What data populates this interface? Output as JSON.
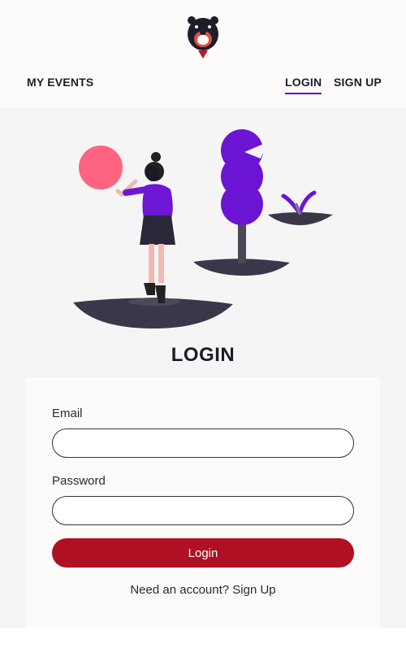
{
  "header": {
    "logo_icon": "bear-mascot-icon",
    "nav_left": "MY EVENTS",
    "nav_login": "LOGIN",
    "nav_signup": "SIGN UP",
    "accent": "#5a0fc8"
  },
  "illustration": {
    "icon": "woman-with-balloon-and-trees-illustration"
  },
  "page": {
    "title": "LOGIN"
  },
  "form": {
    "email_label": "Email",
    "email_value": "",
    "password_label": "Password",
    "password_value": "",
    "login_button": "Login",
    "login_button_color": "#b01024",
    "signup_prompt": "Need an account?",
    "signup_link": "Sign Up"
  }
}
